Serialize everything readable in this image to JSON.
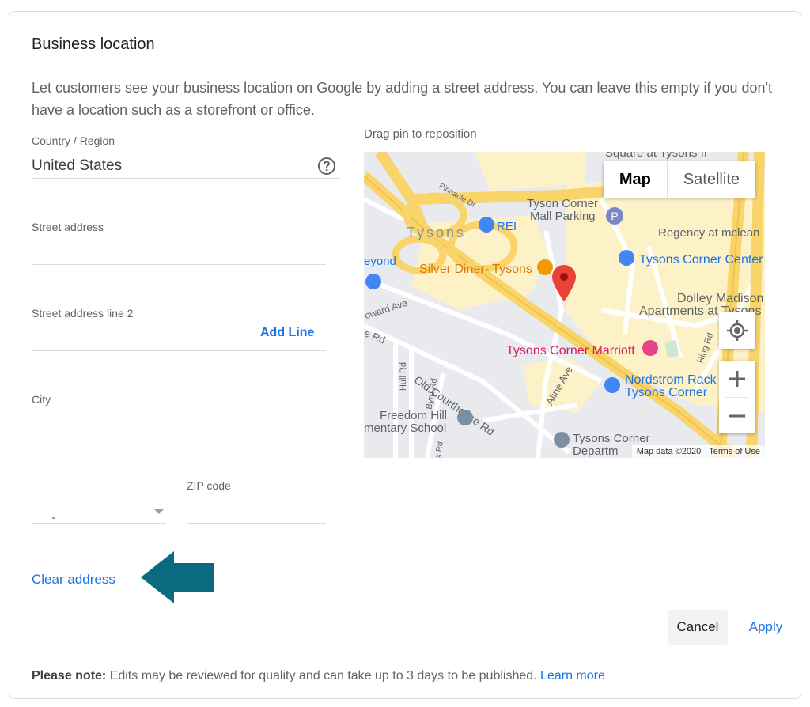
{
  "dialog": {
    "title": "Business location",
    "description": "Let customers see your business location on Google by adding a street address. You can leave this empty if you don't have a location such as a storefront or office."
  },
  "form": {
    "country_label": "Country / Region",
    "country_value": "United States",
    "street_label": "Street address",
    "street2_label": "Street address line 2",
    "add_line": "Add Line",
    "city_label": "City",
    "zip_label": "ZIP code",
    "clear_address": "Clear address"
  },
  "map": {
    "caption": "Drag pin to reposition",
    "type_map": "Map",
    "type_satellite": "Satellite",
    "attribution": "Map data ©2020",
    "terms": "Terms of Use",
    "labels": {
      "square": "Square at Tysons II",
      "tysons": "Tysons",
      "rei": "REI",
      "corner_parking_1": "Tyson Corner",
      "corner_parking_2": "Mall Parking",
      "regency": "Regency at mclean",
      "tcc": "Tysons Corner Center",
      "beyond": "eyond",
      "silver_diner": "Silver Diner- Tysons",
      "dolley_1": "Dolley Madison",
      "dolley_2": "Apartments at Tysons",
      "howard": "oward Ave",
      "rd_left": "e Rd",
      "marriott": "Tysons Corner Marriott",
      "ring_rd": "Ring Rd",
      "old_courthouse": "Old Courthouse Rd",
      "hull_rd": "Hull Rd",
      "byrd_rd": "Byrd Rd",
      "aline": "Aline Ave",
      "nordstrom_1": "Nordstrom Rack",
      "nordstrom_2": "Tysons Corner",
      "freedom_1": "Freedom Hill",
      "freedom_2": "mentary School",
      "pinnacle": "Pinnacle Dr",
      "depart_1": "Tysons Corner",
      "depart_2": "Departm",
      "fox_rd": "ox Rd"
    }
  },
  "actions": {
    "cancel": "Cancel",
    "apply": "Apply"
  },
  "footer": {
    "note_bold": "Please note:",
    "note_text": " Edits may be reviewed for quality and can take up to 3 days to be published. ",
    "learn_more": "Learn more"
  },
  "colors": {
    "accent": "#1a73e8",
    "arrow": "#0a6a80",
    "pin": "#ea4335"
  },
  "icons": {
    "help": "help-circle-icon",
    "locate": "my-location-icon",
    "zoom_in": "plus-icon",
    "zoom_out": "minus-icon",
    "pin": "map-pin-icon",
    "arrow": "arrow-left-icon"
  }
}
